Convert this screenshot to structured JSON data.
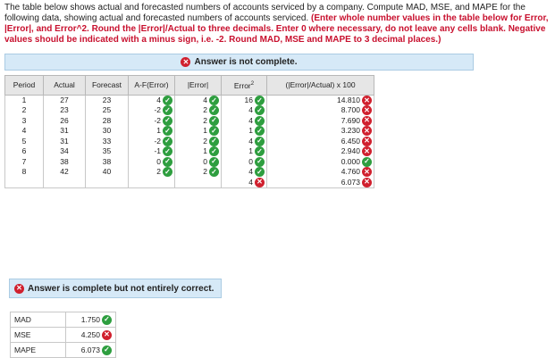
{
  "instructions": {
    "plain": "The table below shows actual and forecasted numbers of accounts serviced by a company. Compute MAD, MSE, and MAPE for the following data, showing actual and forecasted numbers of accounts serviced.",
    "emphasis": "(Enter whole number values in the table below for Error, |Error|, and Error^2. Round the |Error|/Actual to three decimals. Enter 0 where necessary, do not leave any cells blank. Negative values should be indicated with a minus sign, i.e. -2. Round MAD, MSE and MAPE to 3 decimal places.)"
  },
  "banner_top": "Answer is not complete.",
  "table": {
    "headers": {
      "period": "Period",
      "actual": "Actual",
      "forecast": "Forecast",
      "error": "A-F(Error)",
      "abs_error": "|Error|",
      "error_sq": "Error",
      "error_sq_sup": "2",
      "pct": "(|Error|/Actual) x 100"
    },
    "rows": [
      {
        "period": "1",
        "actual": "27",
        "forecast": "23",
        "error": "4",
        "error_s": "correct",
        "abs": "4",
        "abs_s": "correct",
        "sq": "16",
        "sq_s": "correct",
        "pct": "14.810",
        "pct_s": "incorrect"
      },
      {
        "period": "2",
        "actual": "23",
        "forecast": "25",
        "error": "-2",
        "error_s": "correct",
        "abs": "2",
        "abs_s": "correct",
        "sq": "4",
        "sq_s": "correct",
        "pct": "8.700",
        "pct_s": "incorrect"
      },
      {
        "period": "3",
        "actual": "26",
        "forecast": "28",
        "error": "-2",
        "error_s": "correct",
        "abs": "2",
        "abs_s": "correct",
        "sq": "4",
        "sq_s": "correct",
        "pct": "7.690",
        "pct_s": "incorrect"
      },
      {
        "period": "4",
        "actual": "31",
        "forecast": "30",
        "error": "1",
        "error_s": "correct",
        "abs": "1",
        "abs_s": "correct",
        "sq": "1",
        "sq_s": "correct",
        "pct": "3.230",
        "pct_s": "incorrect"
      },
      {
        "period": "5",
        "actual": "31",
        "forecast": "33",
        "error": "-2",
        "error_s": "correct",
        "abs": "2",
        "abs_s": "correct",
        "sq": "4",
        "sq_s": "correct",
        "pct": "6.450",
        "pct_s": "incorrect"
      },
      {
        "period": "6",
        "actual": "34",
        "forecast": "35",
        "error": "-1",
        "error_s": "correct",
        "abs": "1",
        "abs_s": "correct",
        "sq": "1",
        "sq_s": "correct",
        "pct": "2.940",
        "pct_s": "incorrect"
      },
      {
        "period": "7",
        "actual": "38",
        "forecast": "38",
        "error": "0",
        "error_s": "correct",
        "abs": "0",
        "abs_s": "correct",
        "sq": "0",
        "sq_s": "correct",
        "pct": "0.000",
        "pct_s": "correct"
      },
      {
        "period": "8",
        "actual": "42",
        "forecast": "40",
        "error": "2",
        "error_s": "correct",
        "abs": "2",
        "abs_s": "correct",
        "sq": "4",
        "sq_s": "correct",
        "pct": "4.760",
        "pct_s": "incorrect"
      }
    ],
    "totals": {
      "sq": "4",
      "sq_s": "incorrect",
      "pct": "6.073",
      "pct_s": "incorrect"
    }
  },
  "banner_bottom": "Answer is complete but not entirely correct.",
  "errors": [
    {
      "label": "MAD",
      "value": "1.750",
      "status": "correct"
    },
    {
      "label": "MSE",
      "value": "4.250",
      "status": "incorrect"
    },
    {
      "label": "MAPE",
      "value": "6.073",
      "status": "correct"
    }
  ],
  "colors": {
    "correct": "#2e9e3f",
    "incorrect": "#d0202e",
    "banner": "#d6e9f7",
    "emphasis": "#c8102e"
  },
  "icons": {
    "correct": "check-circle-icon",
    "incorrect": "x-circle-icon"
  }
}
